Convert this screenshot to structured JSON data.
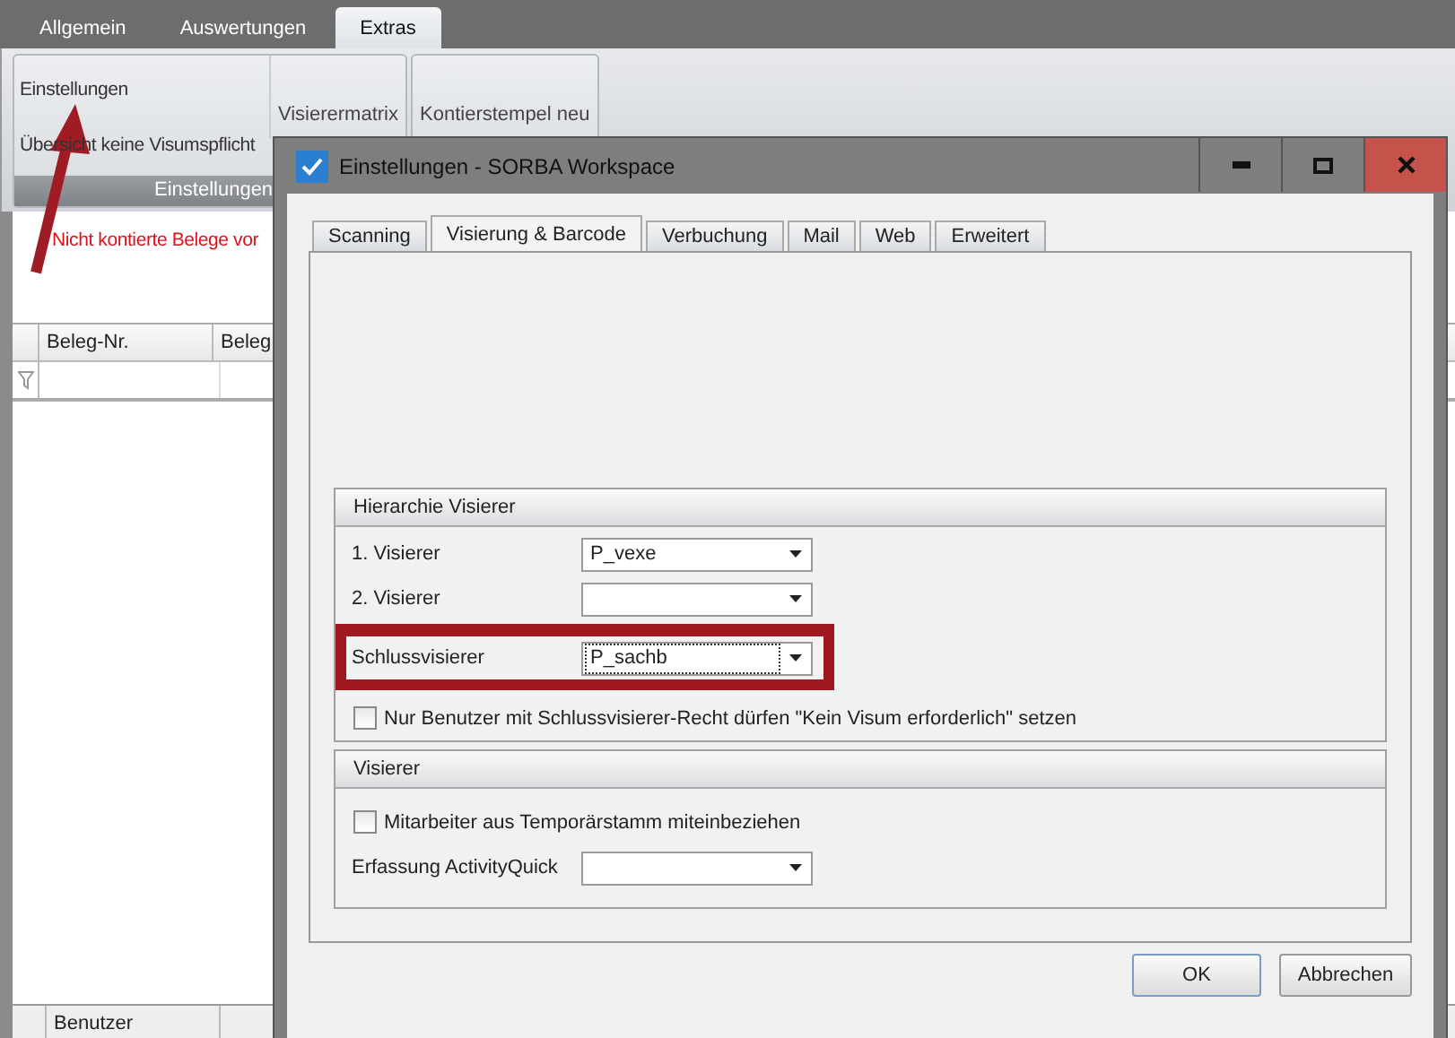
{
  "app_tabs": [
    {
      "label": "Allgemein",
      "selected": false
    },
    {
      "label": "Auswertungen",
      "selected": false
    },
    {
      "label": "Extras",
      "selected": true
    }
  ],
  "ribbon": {
    "group_label": "Einstellungen",
    "commands": [
      {
        "kind": "small",
        "label": "Einstellungen"
      },
      {
        "kind": "small",
        "label": "Übersicht keine Visumspflicht"
      },
      {
        "kind": "large",
        "label": "Visierermatrix"
      }
    ],
    "extra_commands": [
      "Kontierstempel neu"
    ]
  },
  "notice": "Nicht kontierte Belege vor",
  "table": {
    "columns": [
      "Beleg-Nr.",
      "Beleg"
    ]
  },
  "bottom_table": {
    "columns": [
      "Benutzer"
    ]
  },
  "dialog": {
    "title": "Einstellungen - SORBA Workspace",
    "tabs": [
      {
        "label": "Scanning",
        "selected": false
      },
      {
        "label": "Visierung & Barcode",
        "selected": true
      },
      {
        "label": "Verbuchung",
        "selected": false
      },
      {
        "label": "Mail",
        "selected": false
      },
      {
        "label": "Web",
        "selected": false
      },
      {
        "label": "Erweitert",
        "selected": false
      }
    ],
    "groups": [
      {
        "title": "Hierarchie Visierer",
        "rows": [
          {
            "kind": "combo",
            "label": "1. Visierer",
            "value": "P_vexe",
            "highlighted": false,
            "focused": false
          },
          {
            "kind": "combo",
            "label": "2. Visierer",
            "highlighted": false,
            "focused": false
          },
          {
            "kind": "combo",
            "label": "Schlussvisierer",
            "value": "P_sachb",
            "highlighted": true,
            "focused": true
          },
          {
            "kind": "checkbox",
            "label": "Nur Benutzer mit Schlussvisierer-Recht dürfen \"Kein Visum erforderlich\" setzen",
            "checked": false
          }
        ]
      },
      {
        "title": "Visierer",
        "rows": [
          {
            "kind": "checkbox",
            "label": "Mitarbeiter aus Temporärstamm miteinbeziehen",
            "checked": false
          },
          {
            "kind": "combo",
            "label": "Erfassung ActivityQuick",
            "highlighted": false,
            "focused": false
          }
        ]
      }
    ],
    "buttons": [
      "OK",
      "Abbrechen"
    ]
  }
}
